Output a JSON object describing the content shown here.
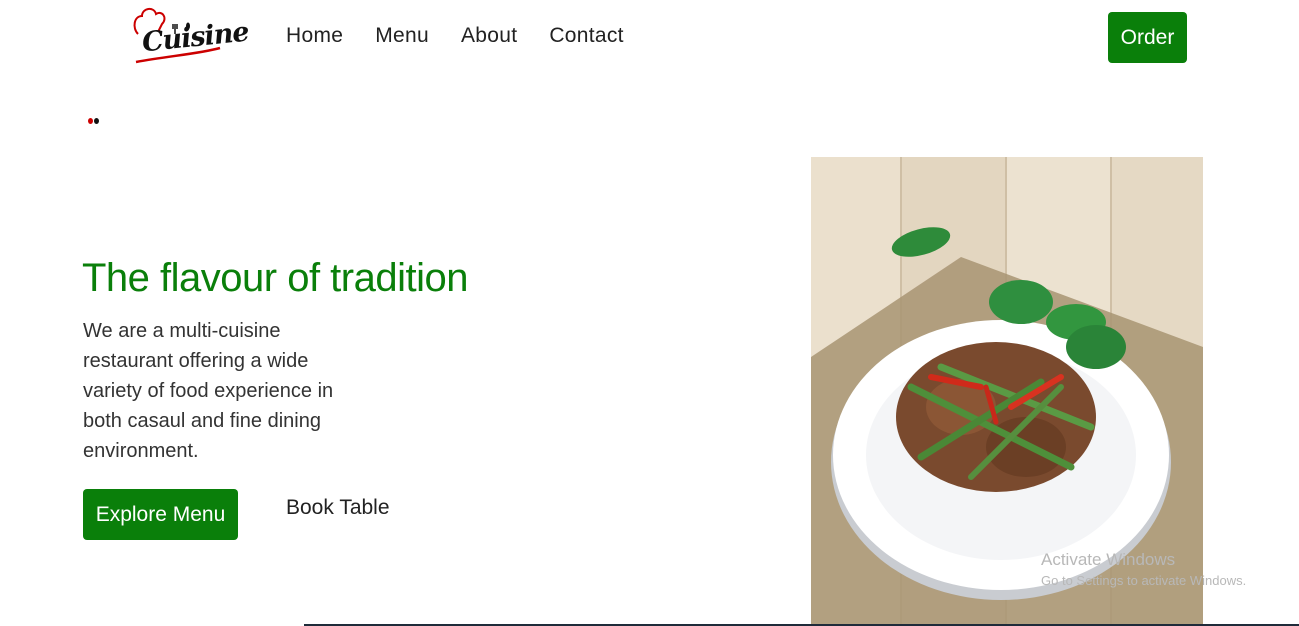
{
  "brand": {
    "logo_text": "Cuisine",
    "primary_color": "#0a7f0a",
    "accent_color": "#cc0000"
  },
  "nav": {
    "items": [
      "Home",
      "Menu",
      "About",
      "Contact"
    ]
  },
  "header": {
    "order_label": "Order"
  },
  "hero": {
    "title": "The flavour of tradition",
    "description": "We are a multi-cuisine restaurant offering a wide variety of food experience in both casaul and fine dining environment.",
    "explore_label": "Explore Menu",
    "book_label": "Book Table"
  },
  "carousel": {
    "indicator_colors": [
      "#cc0000",
      "#111111"
    ]
  },
  "watermark": {
    "title": "Activate Windows",
    "subtitle": "Go to Settings to activate Windows."
  }
}
